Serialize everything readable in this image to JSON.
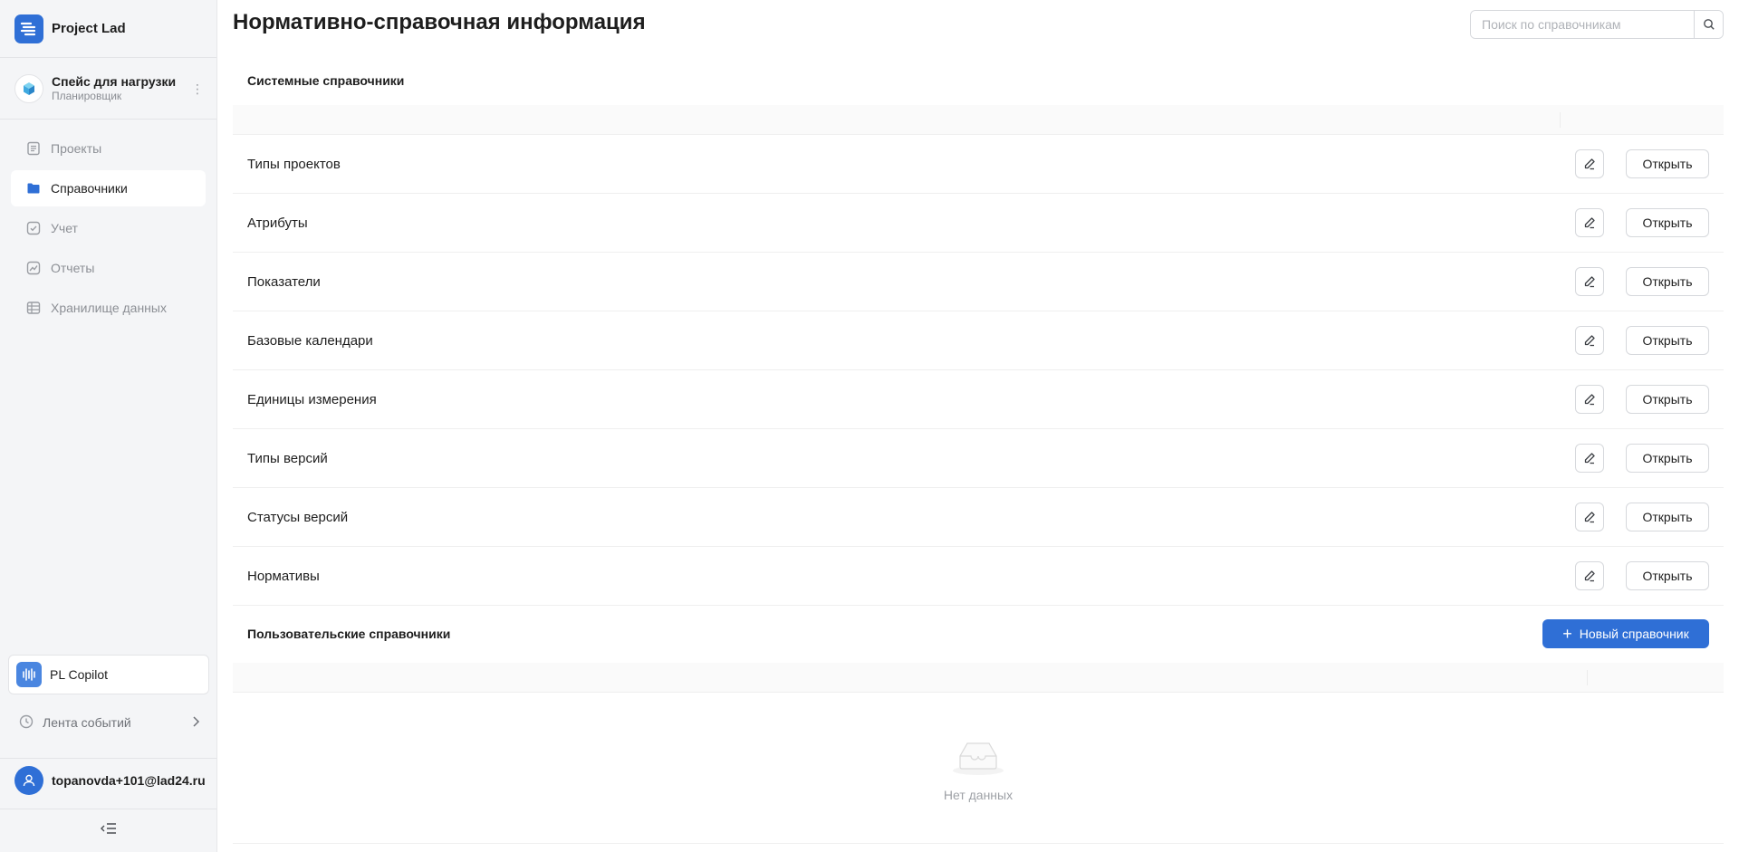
{
  "brand": {
    "name": "Project Lad"
  },
  "space": {
    "title": "Спейс для нагрузки",
    "subtitle": "Планировщик",
    "more": "⋮"
  },
  "nav": {
    "items": [
      {
        "label": "Проекты"
      },
      {
        "label": "Справочники"
      },
      {
        "label": "Учет"
      },
      {
        "label": "Отчеты"
      },
      {
        "label": "Хранилище данных"
      }
    ]
  },
  "copilot": {
    "label": "PL Copilot"
  },
  "feed": {
    "label": "Лента событий"
  },
  "user": {
    "email": "topanovda+101@lad24.ru"
  },
  "header": {
    "title": "Нормативно-справочная информация",
    "search_placeholder": "Поиск по справочникам"
  },
  "system": {
    "title": "Системные справочники",
    "rows": [
      {
        "name": "Типы проектов",
        "open_label": "Открыть"
      },
      {
        "name": "Атрибуты",
        "open_label": "Открыть"
      },
      {
        "name": "Показатели",
        "open_label": "Открыть"
      },
      {
        "name": "Базовые календари",
        "open_label": "Открыть"
      },
      {
        "name": "Единицы измерения",
        "open_label": "Открыть"
      },
      {
        "name": "Типы версий",
        "open_label": "Открыть"
      },
      {
        "name": "Статусы версий",
        "open_label": "Открыть"
      },
      {
        "name": "Нормативы",
        "open_label": "Открыть"
      }
    ]
  },
  "custom": {
    "title": "Пользовательские справочники",
    "new_button": "Новый справочник",
    "empty_text": "Нет данных"
  },
  "colors": {
    "accent": "#2f6fd6",
    "sidebar_bg": "#f4f5f7"
  }
}
